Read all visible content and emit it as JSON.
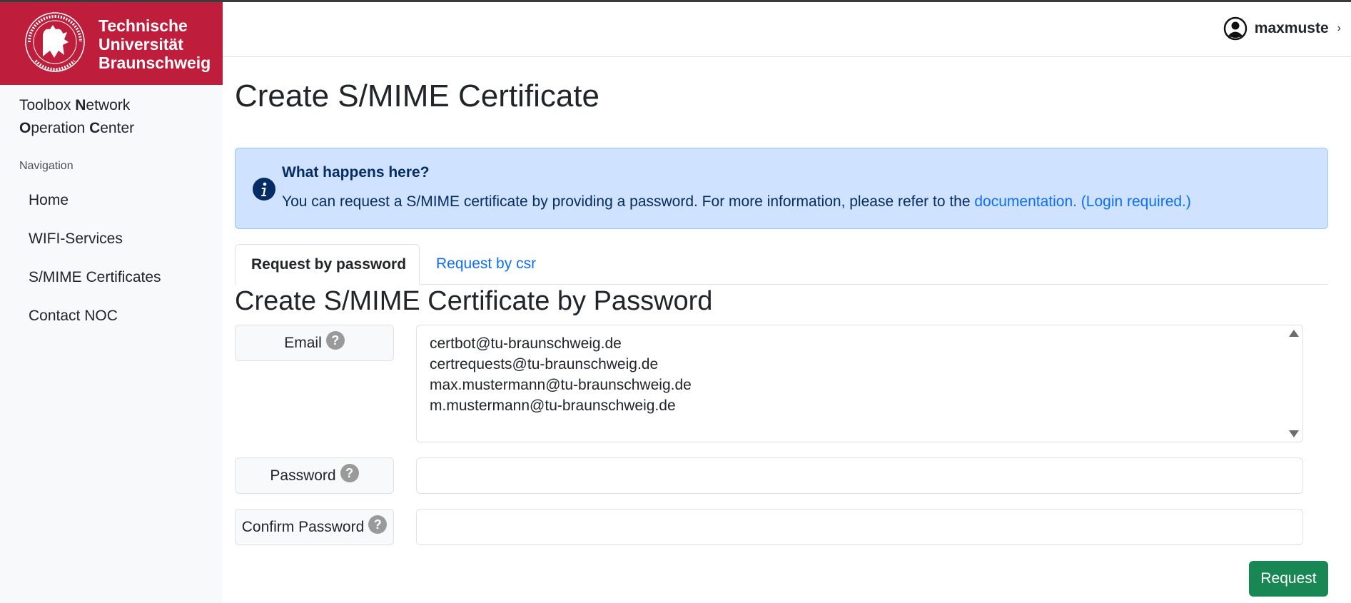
{
  "brand": {
    "line1": "Technische",
    "line2": "Universität",
    "line3": "Braunschweig",
    "seal_text": "CAROLO-WILHELMINA BRAUNSCHWEIG",
    "color": "#be1e3c"
  },
  "sidebar": {
    "app_name_line1_a": "Toolbox ",
    "app_name_line1_b": "N",
    "app_name_line1_c": "etwork",
    "app_name_line2_a": "O",
    "app_name_line2_b": "peration ",
    "app_name_line2_c": "C",
    "app_name_line2_d": "enter",
    "nav_heading": "Navigation",
    "items": [
      {
        "label": "Home"
      },
      {
        "label": "WIFI-Services"
      },
      {
        "label": "S/MIME Certificates"
      },
      {
        "label": "Contact NOC"
      }
    ]
  },
  "header": {
    "username": "maxmuste",
    "user_icon": "user-circle-icon",
    "chevron": "›"
  },
  "main": {
    "title": "Create S/MIME Certificate",
    "alert": {
      "icon": "info-icon",
      "title": "What happens here?",
      "body": "You can request a S/MIME certificate by providing a password. For more information, please refer to the ",
      "link": "documentation. (Login required.)"
    },
    "tabs": [
      {
        "label": "Request by password",
        "active": true
      },
      {
        "label": "Request by csr",
        "active": false
      }
    ],
    "form": {
      "title": "Create S/MIME Certificate by Password",
      "help_glyph": "?",
      "email_label": "Email",
      "emails": [
        "certbot@tu-braunschweig.de",
        "certrequests@tu-braunschweig.de",
        "max.mustermann@tu-braunschweig.de",
        "m.mustermann@tu-braunschweig.de"
      ],
      "password_label": "Password",
      "password_value": "",
      "confirm_label": "Confirm Password",
      "confirm_value": "",
      "submit_label": "Request"
    }
  },
  "colors": {
    "accent": "#0d6efd",
    "success": "#198754",
    "alert_bg": "#cfe2ff"
  }
}
